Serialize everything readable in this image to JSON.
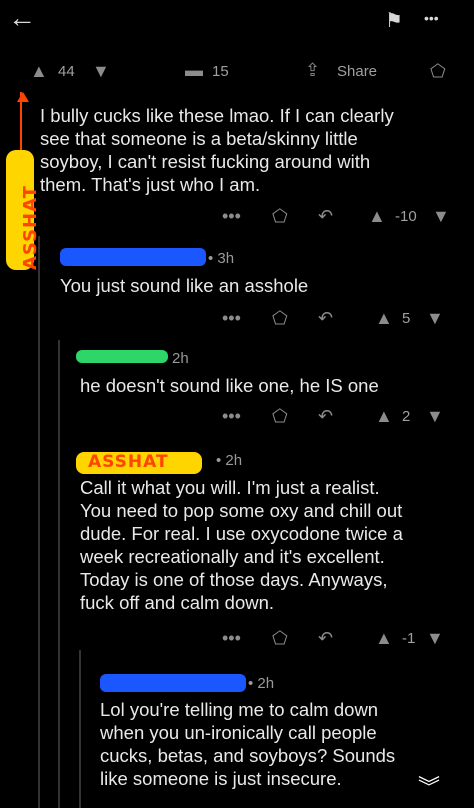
{
  "topbar": {
    "back": "←",
    "save": "⚑",
    "more": "•••"
  },
  "post_actions": {
    "upvotes": "44",
    "comments": "15",
    "share": "Share"
  },
  "annotation": {
    "vertical_text": "ASSHAT"
  },
  "comments": [
    {
      "text": "I bully cucks like these lmao. If I can clearly\nsee that someone is a beta/skinny little\nsoyboy, I can't resist fucking around with\nthem. That's just who I am.",
      "score": "-10"
    },
    {
      "time": "• 3h",
      "text": "You just sound like an asshole",
      "score": "5"
    },
    {
      "time": "2h",
      "text": "he doesn't sound like one, he IS one",
      "score": "2"
    },
    {
      "user_label": "ASSHAT",
      "time": "• 2h",
      "text": "Call it what you will. I'm just a realist.\nYou need to pop some oxy and chill out\ndude. For real. I use oxycodone twice a\nweek recreationally and it's excellent.\nToday is one of those days. Anyways,\nfuck off and calm down.",
      "score": "-1"
    },
    {
      "time": "• 2h",
      "text": "Lol you're telling me to calm down\nwhen you un-ironically call people\ncucks, betas, and soyboys? Sounds\nlike someone is just insecure."
    }
  ],
  "colors": {
    "blue_scribble": "#1a57ff",
    "green_scribble": "#2ed66a",
    "orange_marker": "#ff4400",
    "yellow_marker": "#ffd500"
  }
}
